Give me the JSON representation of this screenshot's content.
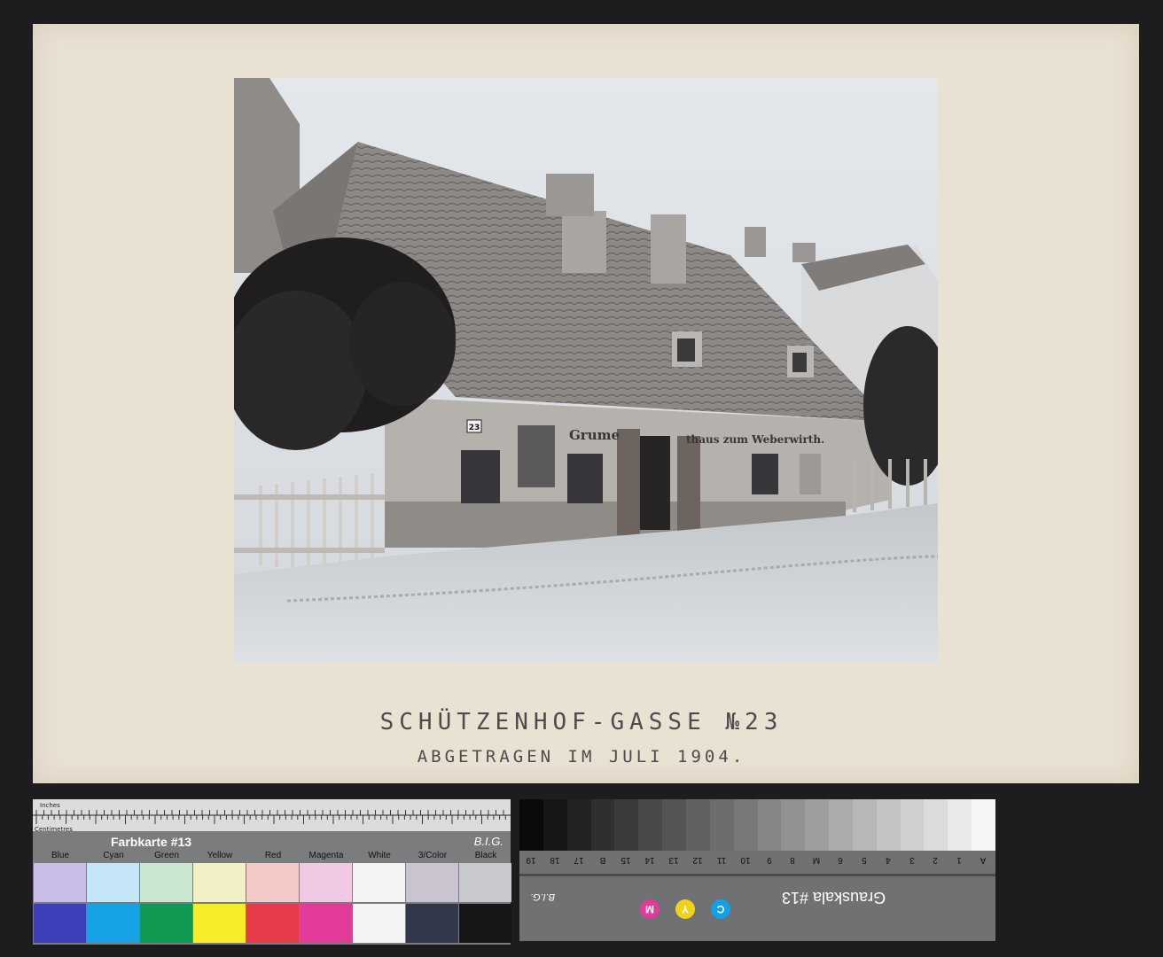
{
  "caption": {
    "title": "SCHÜTZENHOF-GASSE №23",
    "subtitle": "ABGETRAGEN IM JULI 1904."
  },
  "photo": {
    "house_number": "23",
    "shop_sign_left": "Grume",
    "shop_sign_right": "thaus zum Weberwirth."
  },
  "color_card": {
    "title": "Farbkarte #13",
    "brand": "B.I.G.",
    "ruler_label_inches": "Inches",
    "ruler_label_cm": "Centimetres",
    "swatches": [
      {
        "label": "Blue",
        "light": "#c8bde6",
        "dark": "#3c3fb8"
      },
      {
        "label": "Cyan",
        "light": "#c4e6f6",
        "dark": "#16a2e6"
      },
      {
        "label": "Green",
        "light": "#c9e7cf",
        "dark": "#129a54"
      },
      {
        "label": "Yellow",
        "light": "#f4f0c6",
        "dark": "#f6ec2a"
      },
      {
        "label": "Red",
        "light": "#f3c9c8",
        "dark": "#e83b4a"
      },
      {
        "label": "Magenta",
        "light": "#f1c9e4",
        "dark": "#e23b9a"
      },
      {
        "label": "White",
        "light": "#f3f3f6",
        "dark": "#f3f3f6"
      },
      {
        "label": "3/Color",
        "light": "#c9c4cf",
        "dark": "#33374a"
      },
      {
        "label": "Black",
        "light": "#c8c9cc",
        "dark": "#161616"
      }
    ]
  },
  "grey_scale": {
    "title": "Grauskala #13",
    "brand": "B.I.G.",
    "cmy": [
      "C",
      "Y",
      "M"
    ],
    "steps": [
      "19",
      "18",
      "17",
      "B",
      "15",
      "14",
      "13",
      "12",
      "11",
      "10",
      "9",
      "8",
      "M",
      "6",
      "5",
      "4",
      "3",
      "2",
      "1",
      "A"
    ]
  }
}
